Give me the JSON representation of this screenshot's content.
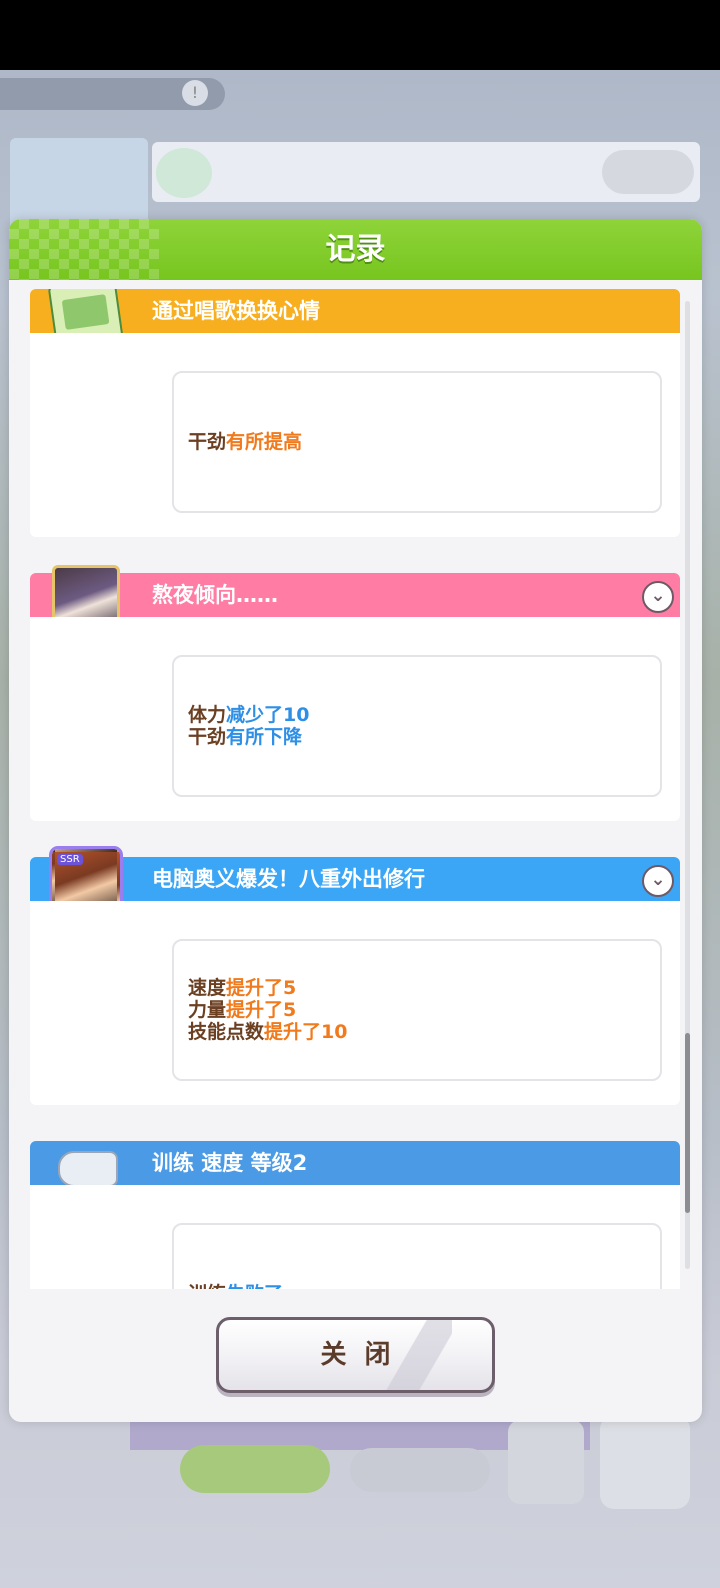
{
  "background": {
    "hud_title": "",
    "turn_text": "",
    "banner_line1": "",
    "banner_line2": ""
  },
  "modal": {
    "title": "记录",
    "close_label": "关闭"
  },
  "entries": [
    {
      "title": "通过唱歌换换心情",
      "color": "#f7ae1f",
      "icon": "event-card-icon",
      "expandable": false,
      "lines": [
        {
          "key": "干劲",
          "change": "有所提高",
          "dir": "up"
        }
      ]
    },
    {
      "title": "熬夜倾向……",
      "color": "#ff7ca4",
      "icon": "character-avatar-icon",
      "expandable": true,
      "lines": [
        {
          "key": "体力",
          "change": "减少了10",
          "dir": "down"
        },
        {
          "key": "干劲",
          "change": "有所下降",
          "dir": "down"
        }
      ]
    },
    {
      "title": "电脑奥义爆发！八重外出修行",
      "color": "#3ba6f5",
      "icon": "ssr-support-card-icon",
      "expandable": true,
      "lines": [
        {
          "key": "速度",
          "change": "提升了5",
          "dir": "up"
        },
        {
          "key": "力量",
          "change": "提升了5",
          "dir": "up"
        },
        {
          "key": "技能点数",
          "change": "提升了10",
          "dir": "up"
        }
      ]
    },
    {
      "title": "训练  速度  等级2",
      "color": "#4a9ae6",
      "icon": "training-shoes-icon",
      "expandable": false,
      "lines": [
        {
          "key": "训练",
          "change": "失败了……",
          "dir": "down"
        }
      ]
    }
  ],
  "colors": {
    "header_green": "#77c51f",
    "up_orange": "#f07a1c",
    "down_blue": "#2d8fe6",
    "text_brown": "#6b3f22"
  }
}
